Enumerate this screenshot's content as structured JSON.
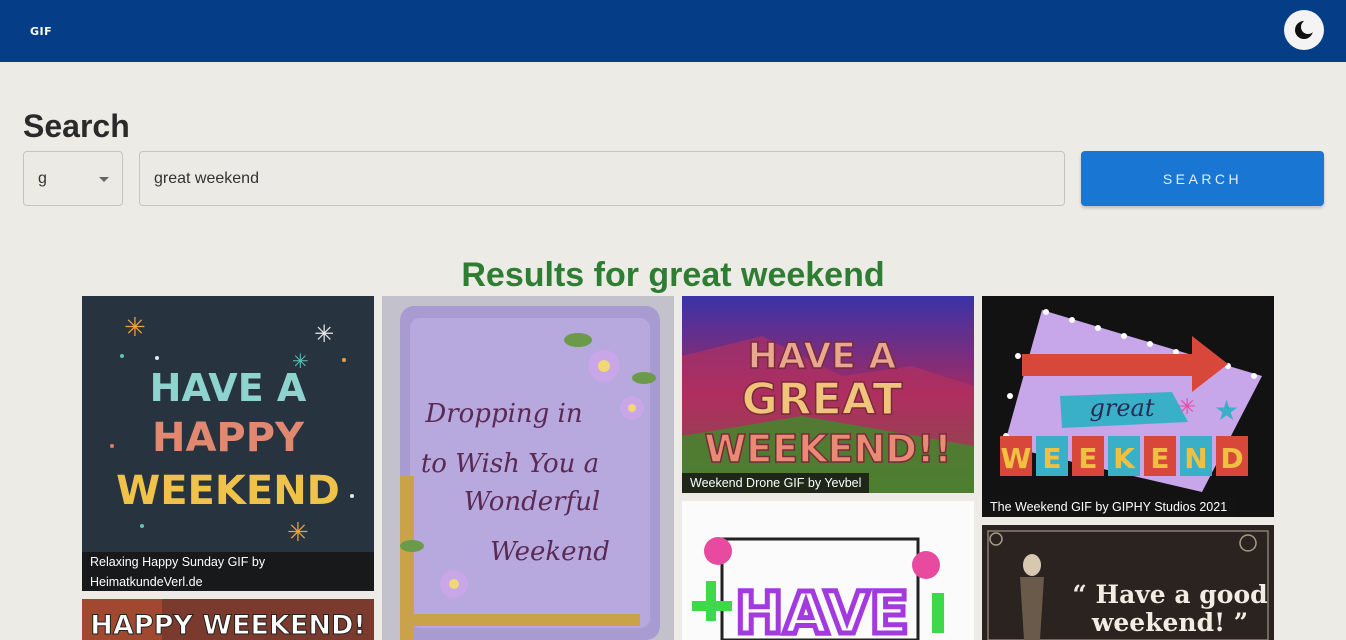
{
  "app": {
    "logo": "GIF"
  },
  "header": {
    "theme_toggle_icon": "moon-icon"
  },
  "search": {
    "heading": "Search",
    "source_value": "g",
    "query_value": "great weekend",
    "button_label": "SEARCH"
  },
  "results": {
    "heading": "Results for great weekend",
    "items": [
      {
        "caption": "Relaxing Happy Sunday GIF by HeimatkundeVerl.de",
        "art_text": [
          "HAVE A",
          "HAPPY",
          "WEEKEND"
        ]
      },
      {
        "caption": "",
        "art_text": [
          "Dropping in",
          "to Wish You a",
          "Wonderful",
          "Weekend"
        ]
      },
      {
        "caption": "Weekend Drone GIF by Yevbel",
        "art_text": [
          "HAVE A",
          "GREAT",
          "WEEKEND!!"
        ]
      },
      {
        "caption": "The Weekend GIF by GIPHY Studios 2021",
        "art_text": [
          "great",
          "W",
          "E",
          "E",
          "K",
          "E",
          "N",
          "D"
        ]
      },
      {
        "caption": "",
        "art_text": [
          "HAPPY WEEKEND!"
        ]
      },
      {
        "caption": "",
        "art_text": [
          "HAVE"
        ]
      },
      {
        "caption": "",
        "art_text": [
          "“ Have a good",
          "weekend! ”"
        ]
      }
    ]
  },
  "colors": {
    "topbar": "#053d87",
    "button": "#1976d2",
    "results_heading": "#2e7d32",
    "background": "#ecebe6"
  }
}
